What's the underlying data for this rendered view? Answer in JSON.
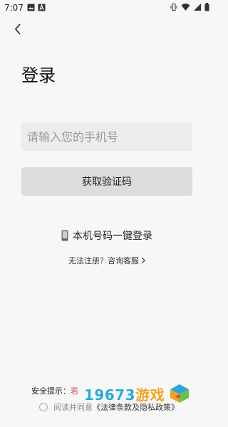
{
  "status_bar": {
    "time": "7:07",
    "left_icons": [
      "image-icon",
      "text-a-icon"
    ],
    "right_icons": [
      "vibrate-icon",
      "wifi-icon",
      "signal-icon",
      "battery-icon"
    ]
  },
  "header": {
    "back_icon": "chevron-left-icon",
    "title": "登录"
  },
  "form": {
    "phone_placeholder": "请输入您的手机号",
    "phone_value": "",
    "get_code_label": "获取验证码"
  },
  "oneclick": {
    "icon": "phone-icon",
    "label": "本机号码一键登录"
  },
  "help": {
    "label": "无法注册？咨询客服",
    "icon": "chevron-right-icon"
  },
  "footer": {
    "security_prefix": "安全提示：",
    "security_red": "若",
    "agree_prefix": "阅读并同意",
    "policy_label": "《法律条款及隐私政策》"
  },
  "watermark": {
    "text_main": "19673",
    "text_game": "游戏"
  },
  "colors": {
    "background": "#f7f7f7",
    "input_bg": "#ececec",
    "button_bg": "#dcdcdc",
    "warning_red": "#e04040",
    "watermark_blue": "#28a8dc"
  }
}
